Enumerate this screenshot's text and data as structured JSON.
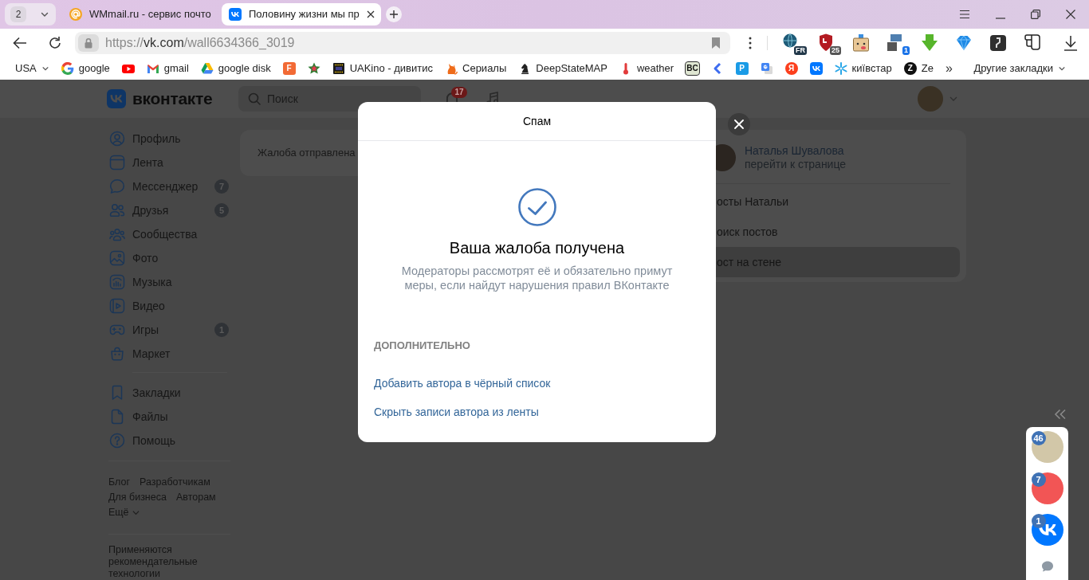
{
  "browser": {
    "tab_count": "2",
    "tabs": [
      {
        "title": "WMmail.ru - сервис почто",
        "kind": "mail",
        "selected": false
      },
      {
        "title": "Половину жизни мы пр",
        "kind": "vk",
        "selected": true
      }
    ],
    "address": {
      "url_parts": [
        {
          "text": "https://",
          "kind": "scheme"
        },
        {
          "text": "vk.com",
          "kind": "host"
        },
        {
          "text": "/wall6634366_3019",
          "kind": "path"
        }
      ]
    },
    "extensions": [
      {
        "kind": "globe",
        "badge": "FR"
      },
      {
        "kind": "shield",
        "badge": "25"
      },
      {
        "kind": "box-face"
      },
      {
        "kind": "screens",
        "badge": "1"
      },
      {
        "kind": "down-arrow"
      },
      {
        "kind": "diamond"
      },
      {
        "kind": "panel"
      },
      {
        "kind": "tag"
      }
    ],
    "bookmarks": [
      {
        "kind": "folder",
        "label": "USA"
      },
      {
        "kind": "google",
        "label": "google"
      },
      {
        "kind": "youtube"
      },
      {
        "kind": "gmail",
        "label": "gmail"
      },
      {
        "kind": "drive",
        "label": "google disk"
      },
      {
        "kind": "letter-tile",
        "glyph": "F",
        "color": "#f26a35"
      },
      {
        "kind": "star"
      },
      {
        "kind": "film",
        "label": "UAKino - дивитис"
      },
      {
        "kind": "cat",
        "label": "Сериалы"
      },
      {
        "kind": "knight",
        "label": "DeepStateMAP"
      },
      {
        "kind": "thermometer",
        "label": "weather"
      },
      {
        "kind": "letter-tile",
        "glyph": "BC",
        "color": "#dfe6d2"
      },
      {
        "kind": "chevron"
      },
      {
        "kind": "letter-tile",
        "glyph": "P",
        "color": "#1a9be6"
      },
      {
        "kind": "translate"
      },
      {
        "kind": "letter-disc",
        "glyph": "Я",
        "color": "#fc3f1d"
      },
      {
        "kind": "vk"
      },
      {
        "kind": "asterisk",
        "label": "київстар"
      },
      {
        "kind": "letter-disc",
        "glyph": "Z",
        "color": "#111111",
        "label": "Ze"
      }
    ],
    "overflow": "»",
    "other_bookmarks": "Другие закладки"
  },
  "vk": {
    "logo": "вконтакте",
    "search_placeholder": "Поиск",
    "notifications": "17",
    "menu": [
      {
        "label": "Профиль",
        "kind": "profile"
      },
      {
        "label": "Лента",
        "kind": "feed"
      },
      {
        "label": "Мессенджер",
        "kind": "messenger",
        "badge": "7"
      },
      {
        "label": "Друзья",
        "kind": "friends",
        "badge": "5"
      },
      {
        "label": "Сообщества",
        "kind": "communities"
      },
      {
        "label": "Фото",
        "kind": "photo"
      },
      {
        "label": "Музыка",
        "kind": "music"
      },
      {
        "label": "Видео",
        "kind": "video"
      },
      {
        "label": "Игры",
        "kind": "games",
        "badge": "1"
      },
      {
        "label": "Маркет",
        "kind": "market"
      }
    ],
    "menu_extra": [
      {
        "label": "Закладки",
        "kind": "bookmarks"
      },
      {
        "label": "Файлы",
        "kind": "files"
      },
      {
        "label": "Помощь",
        "kind": "help"
      }
    ],
    "footer_rows": [
      [
        "Блог",
        "Разработчикам"
      ],
      [
        "Для бизнеса",
        "Авторам"
      ]
    ],
    "more": "Ещё",
    "footer_note": "Применяются рекомендательные технологии",
    "notice": "Жалоба отправлена",
    "author": {
      "name": "Наталья Шувалова",
      "link": "перейти к странице"
    },
    "wall_menu": [
      {
        "label": "осты Натальи",
        "selected": false
      },
      {
        "label": "оиск постов",
        "selected": false
      },
      {
        "label": "ост на стене",
        "selected": true
      }
    ]
  },
  "modal": {
    "title": "Спам",
    "heading": "Ваша жалоба получена",
    "text": "Модераторы рассмотрят её и обязательно примут меры, если найдут нарушения правил ВКонтакте",
    "section": "ДОПОЛНИТЕЛЬНО",
    "actions": [
      "Добавить автора в чёрный список",
      "Скрыть записи автора из ленты"
    ]
  },
  "chats": [
    {
      "kind": "photo",
      "color": "#d2c7a8",
      "badge": "46"
    },
    {
      "kind": "photo",
      "color": "#f25555",
      "badge": "7"
    },
    {
      "kind": "vk",
      "badge": "1"
    }
  ]
}
